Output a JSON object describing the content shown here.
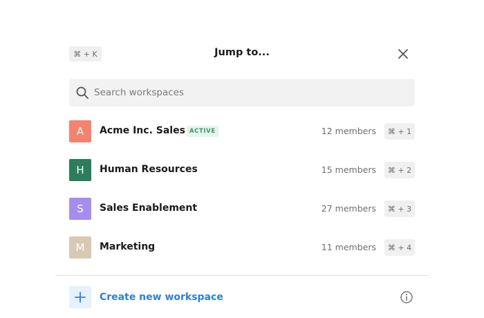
{
  "header": {
    "shortcut": "⌘ + K",
    "title": "Jump to..."
  },
  "search": {
    "placeholder": "Search workspaces",
    "value": ""
  },
  "workspaces": [
    {
      "initial": "A",
      "name": "Acme Inc. Sales",
      "badge": "ACTIVE",
      "members": "12 members",
      "shortcut": "⌘ + 1",
      "color": "#f4826e"
    },
    {
      "initial": "H",
      "name": "Human Resources",
      "members": "15 members",
      "shortcut": "⌘ + 2",
      "color": "#2b7d5c"
    },
    {
      "initial": "S",
      "name": "Sales Enablement",
      "members": "27 members",
      "shortcut": "⌘ + 3",
      "color": "#a58df0"
    },
    {
      "initial": "M",
      "name": "Marketing",
      "members": "11 members",
      "shortcut": "⌘ + 4",
      "color": "#d8c8b4"
    }
  ],
  "footer": {
    "create_label": "Create new workspace"
  },
  "colors": {
    "accent": "#2c7fd6",
    "active_badge": "#2f9e63"
  },
  "icons": {
    "close": "close-icon",
    "search": "search-icon",
    "plus": "plus-icon",
    "info": "info-icon"
  }
}
